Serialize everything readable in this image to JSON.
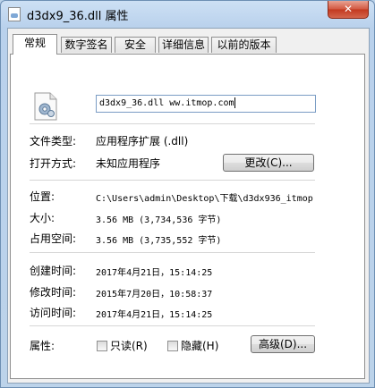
{
  "window": {
    "title": "d3dx9_36.dll 属性",
    "close_label": "✕"
  },
  "tabs": [
    {
      "label": "常规",
      "active": true
    },
    {
      "label": "数字签名",
      "active": false
    },
    {
      "label": "安全",
      "active": false
    },
    {
      "label": "详细信息",
      "active": false
    },
    {
      "label": "以前的版本",
      "active": false
    }
  ],
  "general": {
    "file_icon": "dll-file-gear-icon",
    "filename_value": "d3dx9_36.dll ww.itmop.com",
    "file_type_label": "文件类型:",
    "file_type_value": "应用程序扩展 (.dll)",
    "open_with_label": "打开方式:",
    "open_with_value": "未知应用程序",
    "change_button": "更改(C)...",
    "location_label": "位置:",
    "location_value": "C:\\Users\\admin\\Desktop\\下载\\d3dx936_itmop",
    "size_label": "大小:",
    "size_value": "3.56 MB (3,734,536 字节)",
    "disk_size_label": "占用空间:",
    "disk_size_value": "3.56 MB (3,735,552 字节)",
    "created_label": "创建时间:",
    "created_value": "2017年4月21日，15:14:25",
    "modified_label": "修改时间:",
    "modified_value": "2015年7月20日，10:58:37",
    "accessed_label": "访问时间:",
    "accessed_value": "2017年4月21日，15:14:25",
    "attributes_label": "属性:",
    "readonly_label": "只读(R)",
    "readonly_checked": false,
    "hidden_label": "隐藏(H)",
    "hidden_checked": false,
    "advanced_button": "高级(D)..."
  }
}
